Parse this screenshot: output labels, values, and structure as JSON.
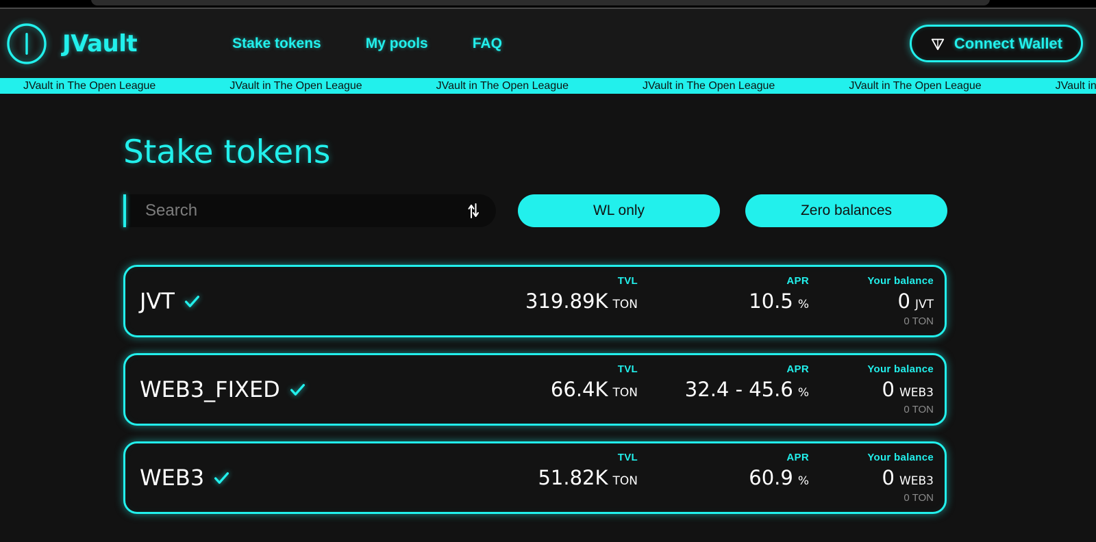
{
  "browser": {
    "chrome_visible": true
  },
  "theme": {
    "background": "#121212",
    "header_background": "#181818",
    "accent": "#22f0ec",
    "text_primary": "#ffffff",
    "text_muted": "#8c8c8c"
  },
  "header": {
    "logo_icon": "jvault-circle-logo-icon",
    "brand": "JVault",
    "nav": [
      {
        "label": "Stake tokens"
      },
      {
        "label": "My pools"
      },
      {
        "label": "FAQ"
      }
    ],
    "connect_wallet": {
      "label": "Connect Wallet",
      "icon": "ton-diamond-icon"
    }
  },
  "ticker": {
    "text": "JVault in The Open League",
    "repeat": 8
  },
  "main": {
    "title": "Stake tokens",
    "search": {
      "placeholder": "Search",
      "value": "",
      "sort_icon": "sort-up-down-icon"
    },
    "filters": [
      {
        "label": "WL only",
        "name": "wl-only"
      },
      {
        "label": "Zero balances",
        "name": "zero-balances"
      }
    ],
    "columns": {
      "tvl": "TVL",
      "apr": "APR",
      "balance": "Your balance"
    },
    "pools": [
      {
        "name": "JVT",
        "verified": true,
        "verified_icon": "check-icon",
        "tvl_value": "319.89K",
        "tvl_unit": "TON",
        "apr_value": "10.5",
        "apr_unit": "%",
        "balance_value": "0",
        "balance_unit": "JVT",
        "balance_sub": "0 TON"
      },
      {
        "name": "WEB3_FIXED",
        "verified": true,
        "verified_icon": "check-icon",
        "tvl_value": "66.4K",
        "tvl_unit": "TON",
        "apr_value": "32.4 - 45.6",
        "apr_unit": "%",
        "balance_value": "0",
        "balance_unit": "WEB3",
        "balance_sub": "0 TON"
      },
      {
        "name": "WEB3",
        "verified": true,
        "verified_icon": "check-icon",
        "tvl_value": "51.82K",
        "tvl_unit": "TON",
        "apr_value": "60.9",
        "apr_unit": "%",
        "balance_value": "0",
        "balance_unit": "WEB3",
        "balance_sub": "0 TON"
      }
    ]
  }
}
